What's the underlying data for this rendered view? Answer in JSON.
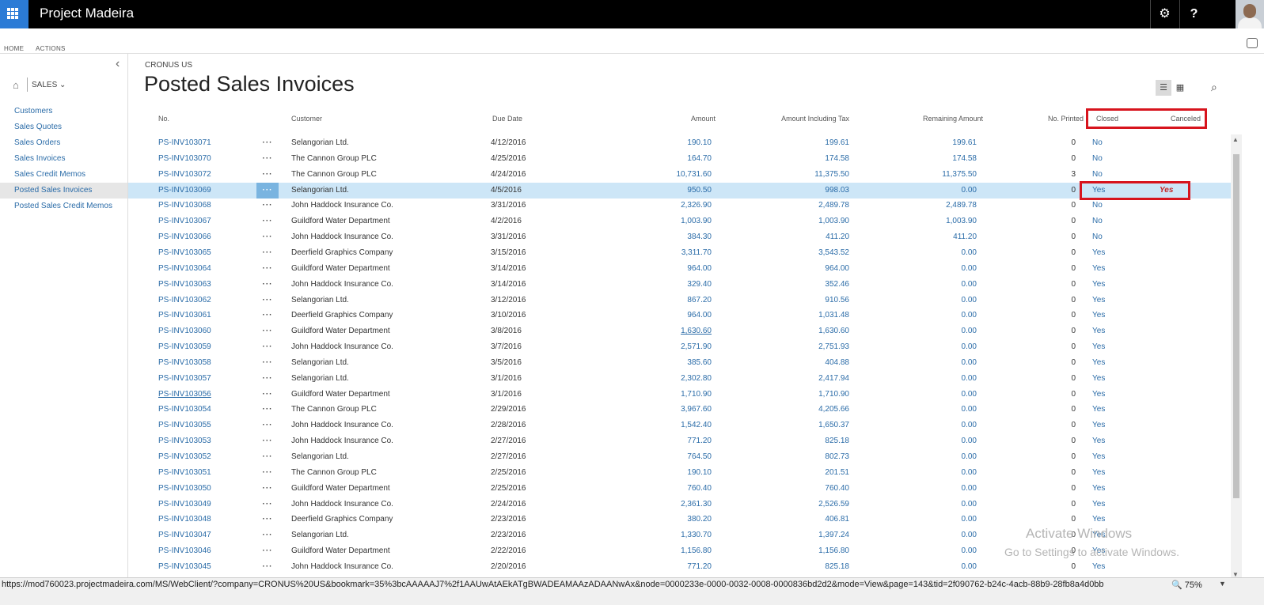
{
  "app": {
    "title": "Project Madeira"
  },
  "ribbon": {
    "tabs": [
      "HOME",
      "ACTIONS"
    ]
  },
  "sidebar": {
    "section": "SALES",
    "items": [
      {
        "label": "Customers",
        "active": false
      },
      {
        "label": "Sales Quotes",
        "active": false
      },
      {
        "label": "Sales Orders",
        "active": false
      },
      {
        "label": "Sales Invoices",
        "active": false
      },
      {
        "label": "Sales Credit Memos",
        "active": false
      },
      {
        "label": "Posted Sales Invoices",
        "active": true
      },
      {
        "label": "Posted Sales Credit Memos",
        "active": false
      }
    ]
  },
  "page": {
    "company": "CRONUS US",
    "title": "Posted Sales Invoices"
  },
  "table": {
    "headers": {
      "no": "No.",
      "customer": "Customer",
      "due": "Due Date",
      "amount": "Amount",
      "amount_tax": "Amount Including Tax",
      "remaining": "Remaining Amount",
      "printed": "No. Printed",
      "closed": "Closed",
      "canceled": "Canceled"
    },
    "rows": [
      {
        "no": "PS-INV103071",
        "customer": "Selangorian Ltd.",
        "due": "4/12/2016",
        "amount": "190.10",
        "amount_tax": "199.61",
        "remaining": "199.61",
        "printed": "0",
        "closed": "No",
        "canceled": ""
      },
      {
        "no": "PS-INV103070",
        "customer": "The Cannon Group PLC",
        "due": "4/25/2016",
        "amount": "164.70",
        "amount_tax": "174.58",
        "remaining": "174.58",
        "printed": "0",
        "closed": "No",
        "canceled": ""
      },
      {
        "no": "PS-INV103072",
        "customer": "The Cannon Group PLC",
        "due": "4/24/2016",
        "amount": "10,731.60",
        "amount_tax": "11,375.50",
        "remaining": "11,375.50",
        "printed": "3",
        "closed": "No",
        "canceled": ""
      },
      {
        "no": "PS-INV103069",
        "customer": "Selangorian Ltd.",
        "due": "4/5/2016",
        "amount": "950.50",
        "amount_tax": "998.03",
        "remaining": "0.00",
        "printed": "0",
        "closed": "Yes",
        "canceled": "Yes",
        "selected": true
      },
      {
        "no": "PS-INV103068",
        "customer": "John Haddock Insurance Co.",
        "due": "3/31/2016",
        "amount": "2,326.90",
        "amount_tax": "2,489.78",
        "remaining": "2,489.78",
        "printed": "0",
        "closed": "No",
        "canceled": ""
      },
      {
        "no": "PS-INV103067",
        "customer": "Guildford Water Department",
        "due": "4/2/2016",
        "amount": "1,003.90",
        "amount_tax": "1,003.90",
        "remaining": "1,003.90",
        "printed": "0",
        "closed": "No",
        "canceled": ""
      },
      {
        "no": "PS-INV103066",
        "customer": "John Haddock Insurance Co.",
        "due": "3/31/2016",
        "amount": "384.30",
        "amount_tax": "411.20",
        "remaining": "411.20",
        "printed": "0",
        "closed": "No",
        "canceled": ""
      },
      {
        "no": "PS-INV103065",
        "customer": "Deerfield Graphics Company",
        "due": "3/15/2016",
        "amount": "3,311.70",
        "amount_tax": "3,543.52",
        "remaining": "0.00",
        "printed": "0",
        "closed": "Yes",
        "canceled": ""
      },
      {
        "no": "PS-INV103064",
        "customer": "Guildford Water Department",
        "due": "3/14/2016",
        "amount": "964.00",
        "amount_tax": "964.00",
        "remaining": "0.00",
        "printed": "0",
        "closed": "Yes",
        "canceled": ""
      },
      {
        "no": "PS-INV103063",
        "customer": "John Haddock Insurance Co.",
        "due": "3/14/2016",
        "amount": "329.40",
        "amount_tax": "352.46",
        "remaining": "0.00",
        "printed": "0",
        "closed": "Yes",
        "canceled": ""
      },
      {
        "no": "PS-INV103062",
        "customer": "Selangorian Ltd.",
        "due": "3/12/2016",
        "amount": "867.20",
        "amount_tax": "910.56",
        "remaining": "0.00",
        "printed": "0",
        "closed": "Yes",
        "canceled": ""
      },
      {
        "no": "PS-INV103061",
        "customer": "Deerfield Graphics Company",
        "due": "3/10/2016",
        "amount": "964.00",
        "amount_tax": "1,031.48",
        "remaining": "0.00",
        "printed": "0",
        "closed": "Yes",
        "canceled": ""
      },
      {
        "no": "PS-INV103060",
        "customer": "Guildford Water Department",
        "due": "3/8/2016",
        "amount": "1,630.60",
        "amount_tax": "1,630.60",
        "remaining": "0.00",
        "printed": "0",
        "closed": "Yes",
        "canceled": "",
        "amount_link": true
      },
      {
        "no": "PS-INV103059",
        "customer": "John Haddock Insurance Co.",
        "due": "3/7/2016",
        "amount": "2,571.90",
        "amount_tax": "2,751.93",
        "remaining": "0.00",
        "printed": "0",
        "closed": "Yes",
        "canceled": ""
      },
      {
        "no": "PS-INV103058",
        "customer": "Selangorian Ltd.",
        "due": "3/5/2016",
        "amount": "385.60",
        "amount_tax": "404.88",
        "remaining": "0.00",
        "printed": "0",
        "closed": "Yes",
        "canceled": ""
      },
      {
        "no": "PS-INV103057",
        "customer": "Selangorian Ltd.",
        "due": "3/1/2016",
        "amount": "2,302.80",
        "amount_tax": "2,417.94",
        "remaining": "0.00",
        "printed": "0",
        "closed": "Yes",
        "canceled": ""
      },
      {
        "no": "PS-INV103056",
        "customer": "Guildford Water Department",
        "due": "3/1/2016",
        "amount": "1,710.90",
        "amount_tax": "1,710.90",
        "remaining": "0.00",
        "printed": "0",
        "closed": "Yes",
        "canceled": "",
        "no_link": true
      },
      {
        "no": "PS-INV103054",
        "customer": "The Cannon Group PLC",
        "due": "2/29/2016",
        "amount": "3,967.60",
        "amount_tax": "4,205.66",
        "remaining": "0.00",
        "printed": "0",
        "closed": "Yes",
        "canceled": ""
      },
      {
        "no": "PS-INV103055",
        "customer": "John Haddock Insurance Co.",
        "due": "2/28/2016",
        "amount": "1,542.40",
        "amount_tax": "1,650.37",
        "remaining": "0.00",
        "printed": "0",
        "closed": "Yes",
        "canceled": ""
      },
      {
        "no": "PS-INV103053",
        "customer": "John Haddock Insurance Co.",
        "due": "2/27/2016",
        "amount": "771.20",
        "amount_tax": "825.18",
        "remaining": "0.00",
        "printed": "0",
        "closed": "Yes",
        "canceled": ""
      },
      {
        "no": "PS-INV103052",
        "customer": "Selangorian Ltd.",
        "due": "2/27/2016",
        "amount": "764.50",
        "amount_tax": "802.73",
        "remaining": "0.00",
        "printed": "0",
        "closed": "Yes",
        "canceled": ""
      },
      {
        "no": "PS-INV103051",
        "customer": "The Cannon Group PLC",
        "due": "2/25/2016",
        "amount": "190.10",
        "amount_tax": "201.51",
        "remaining": "0.00",
        "printed": "0",
        "closed": "Yes",
        "canceled": ""
      },
      {
        "no": "PS-INV103050",
        "customer": "Guildford Water Department",
        "due": "2/25/2016",
        "amount": "760.40",
        "amount_tax": "760.40",
        "remaining": "0.00",
        "printed": "0",
        "closed": "Yes",
        "canceled": ""
      },
      {
        "no": "PS-INV103049",
        "customer": "John Haddock Insurance Co.",
        "due": "2/24/2016",
        "amount": "2,361.30",
        "amount_tax": "2,526.59",
        "remaining": "0.00",
        "printed": "0",
        "closed": "Yes",
        "canceled": ""
      },
      {
        "no": "PS-INV103048",
        "customer": "Deerfield Graphics Company",
        "due": "2/23/2016",
        "amount": "380.20",
        "amount_tax": "406.81",
        "remaining": "0.00",
        "printed": "0",
        "closed": "Yes",
        "canceled": ""
      },
      {
        "no": "PS-INV103047",
        "customer": "Selangorian Ltd.",
        "due": "2/23/2016",
        "amount": "1,330.70",
        "amount_tax": "1,397.24",
        "remaining": "0.00",
        "printed": "0",
        "closed": "Yes",
        "canceled": ""
      },
      {
        "no": "PS-INV103046",
        "customer": "Guildford Water Department",
        "due": "2/22/2016",
        "amount": "1,156.80",
        "amount_tax": "1,156.80",
        "remaining": "0.00",
        "printed": "0",
        "closed": "Yes",
        "canceled": ""
      },
      {
        "no": "PS-INV103045",
        "customer": "John Haddock Insurance Co.",
        "due": "2/20/2016",
        "amount": "771.20",
        "amount_tax": "825.18",
        "remaining": "0.00",
        "printed": "0",
        "closed": "Yes",
        "canceled": ""
      }
    ]
  },
  "watermark": {
    "line1": "Activate Windows",
    "line2": "Go to Settings to activate Windows."
  },
  "statusbar": {
    "url": "https://mod760023.projectmadeira.com/MS/WebClient/?company=CRONUS%20US&bookmark=35%3bcAAAAAJ7%2f1AAUwAtAEkATgBWADEAMAAzADAANwAx&node=0000233e-0000-0032-0008-0000836bd2d2&mode=View&page=143&tid=2f090762-b24c-4acb-88b9-28fb8a4d0bb",
    "zoom": "75%"
  },
  "colors": {
    "accent": "#2b7bd6",
    "link": "#2b6ca8",
    "highlight": "#d7141d",
    "selected_row": "#cde6f7"
  }
}
